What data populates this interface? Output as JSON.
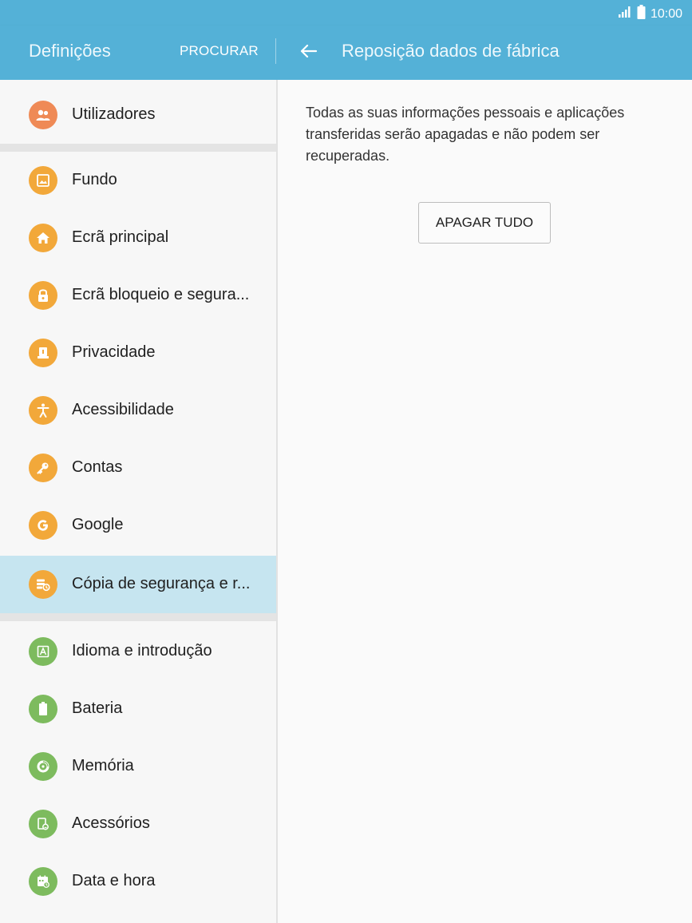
{
  "status": {
    "time": "10:00"
  },
  "header": {
    "left_title": "Definições",
    "search_label": "PROCURAR",
    "right_title": "Reposição dados de fábrica"
  },
  "sidebar": {
    "items": [
      {
        "label": "Utilizadores",
        "icon": "users-icon",
        "color": "#ef8a56"
      },
      {
        "label": "Fundo",
        "icon": "wallpaper-icon",
        "color": "#f2a83a"
      },
      {
        "label": "Ecrã principal",
        "icon": "home-icon",
        "color": "#f2a83a"
      },
      {
        "label": "Ecrã bloqueio e segura...",
        "icon": "lock-icon",
        "color": "#f2a83a"
      },
      {
        "label": "Privacidade",
        "icon": "privacy-icon",
        "color": "#f2a83a"
      },
      {
        "label": "Acessibilidade",
        "icon": "accessibility-icon",
        "color": "#f2a83a"
      },
      {
        "label": "Contas",
        "icon": "key-icon",
        "color": "#f2a83a"
      },
      {
        "label": "Google",
        "icon": "google-icon",
        "color": "#f2a83a"
      },
      {
        "label": "Cópia de segurança e r...",
        "icon": "backup-icon",
        "color": "#f2a83a",
        "selected": true
      },
      {
        "label": "Idioma e introdução",
        "icon": "language-icon",
        "color": "#7dbb5e"
      },
      {
        "label": "Bateria",
        "icon": "battery-icon",
        "color": "#7dbb5e"
      },
      {
        "label": "Memória",
        "icon": "memory-icon",
        "color": "#7dbb5e"
      },
      {
        "label": "Acessórios",
        "icon": "accessories-icon",
        "color": "#7dbb5e"
      },
      {
        "label": "Data e hora",
        "icon": "calendar-icon",
        "color": "#7dbb5e"
      }
    ]
  },
  "main": {
    "description": "Todas as suas informações pessoais e aplicações transferidas serão apagadas e não podem ser recuperadas.",
    "erase_label": "APAGAR TUDO"
  },
  "colors": {
    "accent": "#54b1d7",
    "selected": "#c6e5f0"
  }
}
